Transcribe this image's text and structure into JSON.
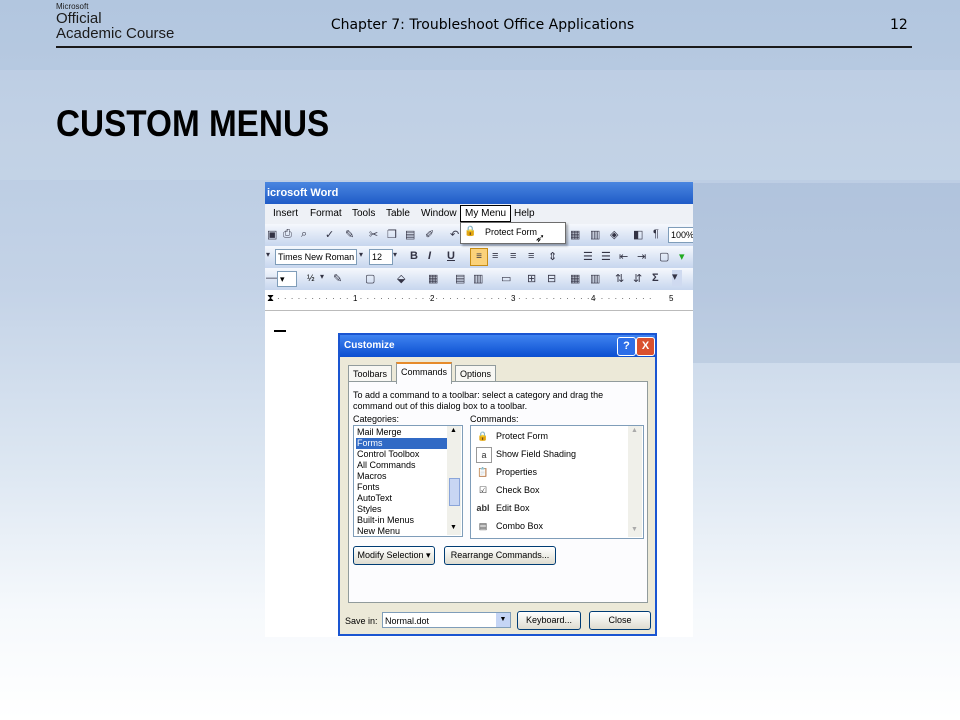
{
  "header": {
    "logo": {
      "microsoft": "Microsoft",
      "line1": "Official",
      "line2": "Academic Course"
    },
    "chapter_title": "Chapter 7: Troubleshoot Office Applications",
    "page_number": "12"
  },
  "slide": {
    "title": "CUSTOM MENUS"
  },
  "word": {
    "title": "icrosoft Word",
    "menus": [
      "Insert",
      "Format",
      "Tools",
      "Table",
      "Window",
      "My Menu",
      "Help"
    ],
    "dropdown_item": "Protect Form",
    "zoom": "100%",
    "font_name": "Times New Roman",
    "font_size": "12",
    "half_label": "½",
    "ruler_marks": [
      "1",
      "2",
      "3",
      "4",
      "5"
    ]
  },
  "dialog": {
    "title": "Customize",
    "help": "?",
    "close": "X",
    "tabs": [
      "Toolbars",
      "Commands",
      "Options"
    ],
    "instruction_line1": "To add a command to a toolbar: select a category and drag the",
    "instruction_line2": "command out of this dialog box to a toolbar.",
    "categories_label": "Categories:",
    "commands_label": "Commands:",
    "categories": [
      "Mail Merge",
      "Forms",
      "Control Toolbox",
      "All Commands",
      "Macros",
      "Fonts",
      "AutoText",
      "Styles",
      "Built-in Menus",
      "New Menu"
    ],
    "selected_category": "Forms",
    "commands": [
      "Protect Form",
      "Show Field Shading",
      "Properties",
      "Check Box",
      "Edit Box",
      "Combo Box"
    ],
    "command_glyphs": [
      "🔒",
      "a",
      "📋",
      "☑",
      "abl",
      "▤"
    ],
    "modify_selection": "Modify Selection ▾",
    "rearrange_commands": "Rearrange Commands...",
    "save_in_label": "Save in:",
    "save_in_value": "Normal.dot",
    "keyboard_button": "Keyboard...",
    "close_button": "Close"
  },
  "colors": {
    "titlebar": "#1f5bc7",
    "selection": "#316ac5",
    "dialog_face": "#ece9d8"
  }
}
